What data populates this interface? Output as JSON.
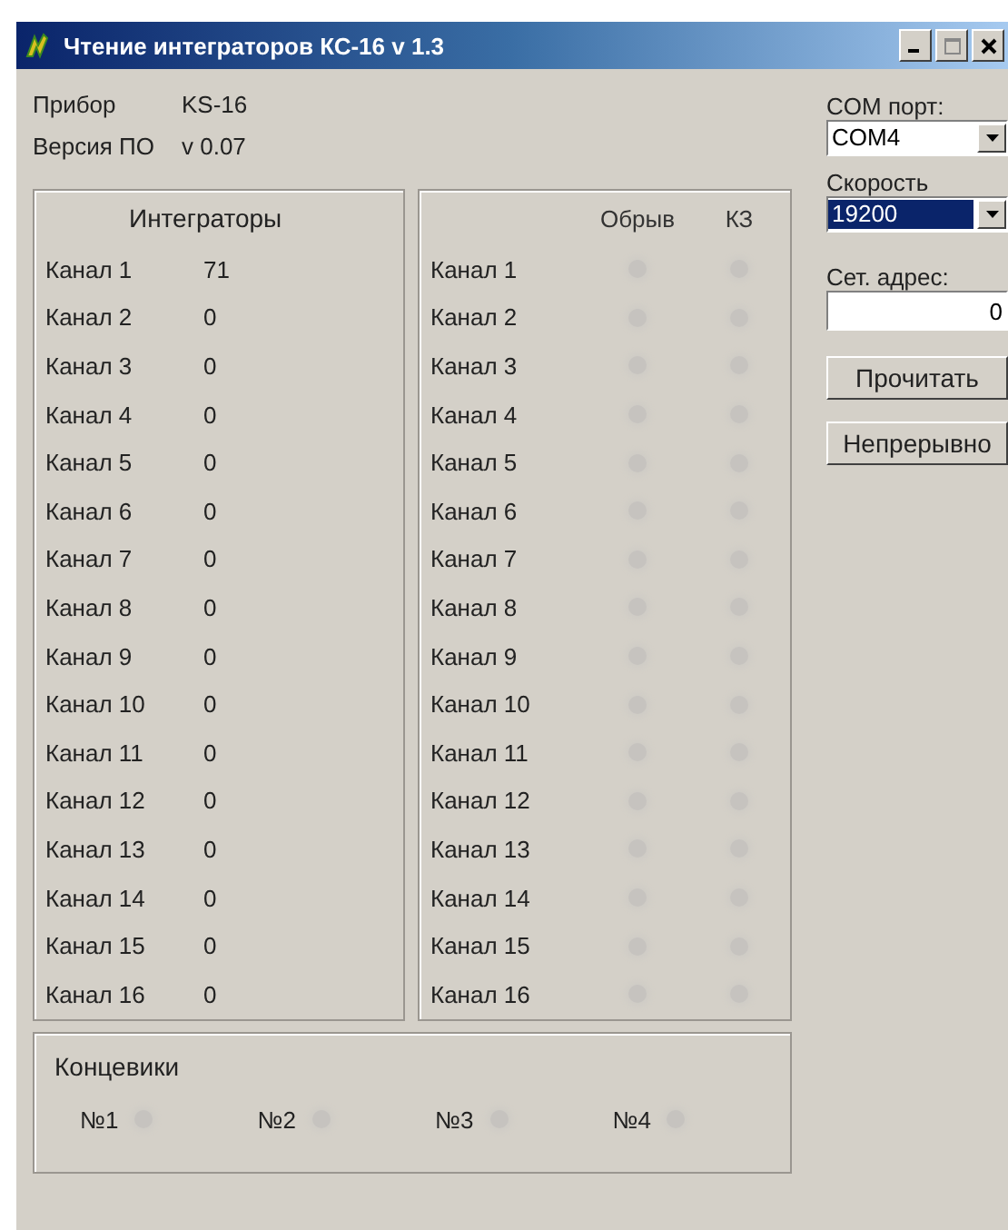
{
  "window": {
    "title": "Чтение интеграторов КС-16 v 1.3"
  },
  "device": {
    "label": "Прибор",
    "value": "KS-16"
  },
  "firmware": {
    "label": "Версия ПО",
    "value": "v 0.07"
  },
  "integrators": {
    "title": "Интеграторы",
    "rows": [
      {
        "name": "Канал 1",
        "value": "71"
      },
      {
        "name": "Канал 2",
        "value": "0"
      },
      {
        "name": "Канал 3",
        "value": "0"
      },
      {
        "name": "Канал 4",
        "value": "0"
      },
      {
        "name": "Канал 5",
        "value": "0"
      },
      {
        "name": "Канал 6",
        "value": "0"
      },
      {
        "name": "Канал 7",
        "value": "0"
      },
      {
        "name": "Канал 8",
        "value": "0"
      },
      {
        "name": "Канал 9",
        "value": "0"
      },
      {
        "name": "Канал 10",
        "value": "0"
      },
      {
        "name": "Канал 11",
        "value": "0"
      },
      {
        "name": "Канал 12",
        "value": "0"
      },
      {
        "name": "Канал 13",
        "value": "0"
      },
      {
        "name": "Канал 14",
        "value": "0"
      },
      {
        "name": "Канал 15",
        "value": "0"
      },
      {
        "name": "Канал 16",
        "value": "0"
      }
    ]
  },
  "faults": {
    "columns": [
      "Обрыв",
      "КЗ"
    ],
    "rows": [
      {
        "name": "Канал 1",
        "break_on": false,
        "short_on": false
      },
      {
        "name": "Канал 2",
        "break_on": false,
        "short_on": false
      },
      {
        "name": "Канал 3",
        "break_on": false,
        "short_on": false
      },
      {
        "name": "Канал 4",
        "break_on": false,
        "short_on": false
      },
      {
        "name": "Канал 5",
        "break_on": false,
        "short_on": false
      },
      {
        "name": "Канал 6",
        "break_on": false,
        "short_on": false
      },
      {
        "name": "Канал 7",
        "break_on": false,
        "short_on": false
      },
      {
        "name": "Канал 8",
        "break_on": false,
        "short_on": false
      },
      {
        "name": "Канал 9",
        "break_on": false,
        "short_on": false
      },
      {
        "name": "Канал 10",
        "break_on": false,
        "short_on": false
      },
      {
        "name": "Канал 11",
        "break_on": false,
        "short_on": false
      },
      {
        "name": "Канал 12",
        "break_on": false,
        "short_on": false
      },
      {
        "name": "Канал 13",
        "break_on": false,
        "short_on": false
      },
      {
        "name": "Канал 14",
        "break_on": false,
        "short_on": false
      },
      {
        "name": "Канал 15",
        "break_on": false,
        "short_on": false
      },
      {
        "name": "Канал 16",
        "break_on": false,
        "short_on": false
      }
    ]
  },
  "limit_switches": {
    "title": "Концевики",
    "items": [
      {
        "label": "№1",
        "on": false
      },
      {
        "label": "№2",
        "on": false
      },
      {
        "label": "№3",
        "on": false
      },
      {
        "label": "№4",
        "on": false
      }
    ]
  },
  "settings": {
    "com_port": {
      "label": "COM порт:",
      "value": "COM4",
      "selected": false
    },
    "speed": {
      "label": "Скорость",
      "value": "19200",
      "selected": true
    },
    "address": {
      "label": "Сет. адрес:",
      "value": "0"
    }
  },
  "buttons": [
    "Прочитать",
    "Непрерывно"
  ]
}
